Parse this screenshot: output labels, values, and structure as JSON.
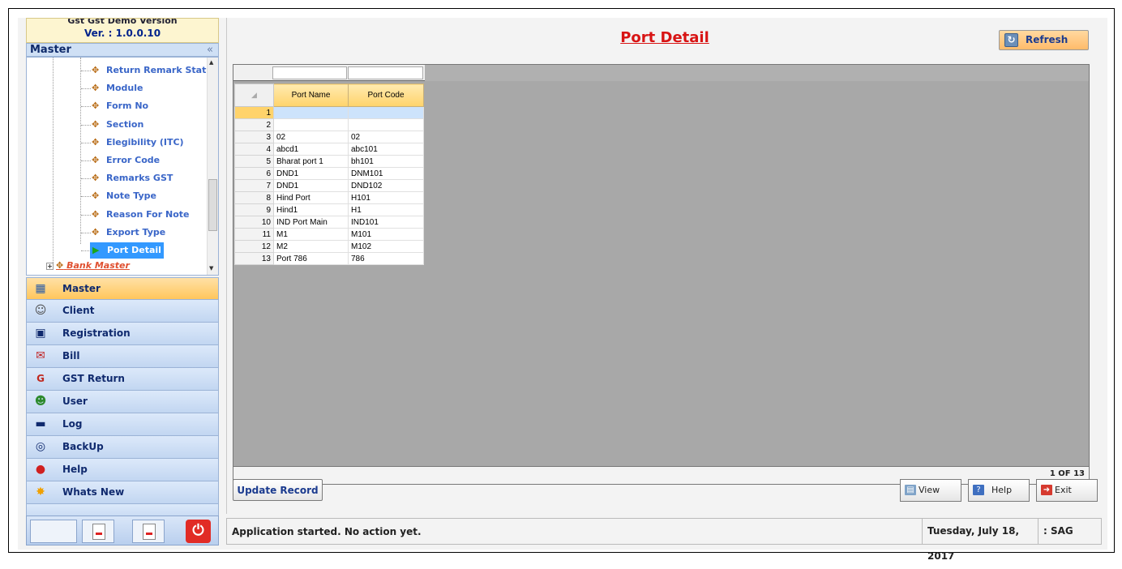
{
  "version": {
    "cut_text": "Gst Gst Demo Version",
    "label": "Ver. : 1.0.0.10"
  },
  "master_panel": {
    "title": "Master",
    "collapse": "«"
  },
  "tree": {
    "items": [
      "Return Remark Status",
      "Module",
      "Form No",
      "Section",
      "Elegibility (ITC)",
      "Error Code",
      "Remarks GST",
      "Note Type",
      "Reason For Note",
      "Export Type",
      "Port Detail"
    ],
    "selected": "Port Detail",
    "next_group": "Bank Master"
  },
  "nav": {
    "items": [
      {
        "label": "Master",
        "icon": "master-icon"
      },
      {
        "label": "Client",
        "icon": "client-icon"
      },
      {
        "label": "Registration",
        "icon": "registration-icon"
      },
      {
        "label": "Bill",
        "icon": "bill-icon"
      },
      {
        "label": "GST Return",
        "icon": "gst-icon"
      },
      {
        "label": "User",
        "icon": "user-icon"
      },
      {
        "label": "Log",
        "icon": "log-icon"
      },
      {
        "label": "BackUp",
        "icon": "backup-icon"
      },
      {
        "label": "Help",
        "icon": "help-icon"
      },
      {
        "label": "Whats New",
        "icon": "new-icon"
      }
    ],
    "active": "Master"
  },
  "page": {
    "title": "Port Detail",
    "refresh_label": "Refresh"
  },
  "grid": {
    "columns": [
      "Port Name",
      "Port Code"
    ],
    "rows": [
      {
        "n": "1",
        "name": "",
        "code": ""
      },
      {
        "n": "2",
        "name": "",
        "code": ""
      },
      {
        "n": "3",
        "name": "02",
        "code": "02"
      },
      {
        "n": "4",
        "name": "abcd1",
        "code": "abc101"
      },
      {
        "n": "5",
        "name": "Bharat port 1",
        "code": "bh101"
      },
      {
        "n": "6",
        "name": "DND1",
        "code": "DNM101"
      },
      {
        "n": "7",
        "name": "DND1",
        "code": "DND102"
      },
      {
        "n": "8",
        "name": "Hind Port",
        "code": "H101"
      },
      {
        "n": "9",
        "name": "Hind1",
        "code": "H1"
      },
      {
        "n": "10",
        "name": "IND Port Main",
        "code": "IND101"
      },
      {
        "n": "11",
        "name": "M1",
        "code": "M101"
      },
      {
        "n": "12",
        "name": "M2",
        "code": "M102"
      },
      {
        "n": "13",
        "name": "Port 786",
        "code": "786"
      }
    ],
    "pager": "1 OF 13"
  },
  "actions": {
    "update": "Update Record",
    "view": "View",
    "help": "Help",
    "exit": "Exit"
  },
  "status": {
    "message": "Application started. No action yet.",
    "date": "Tuesday, July 18, 2017",
    "user": ": SAG"
  },
  "colors": {
    "title": "#d81414",
    "active_nav": "#ffc65c",
    "nav": "#c2d6f1",
    "selection": "#3399ff"
  }
}
